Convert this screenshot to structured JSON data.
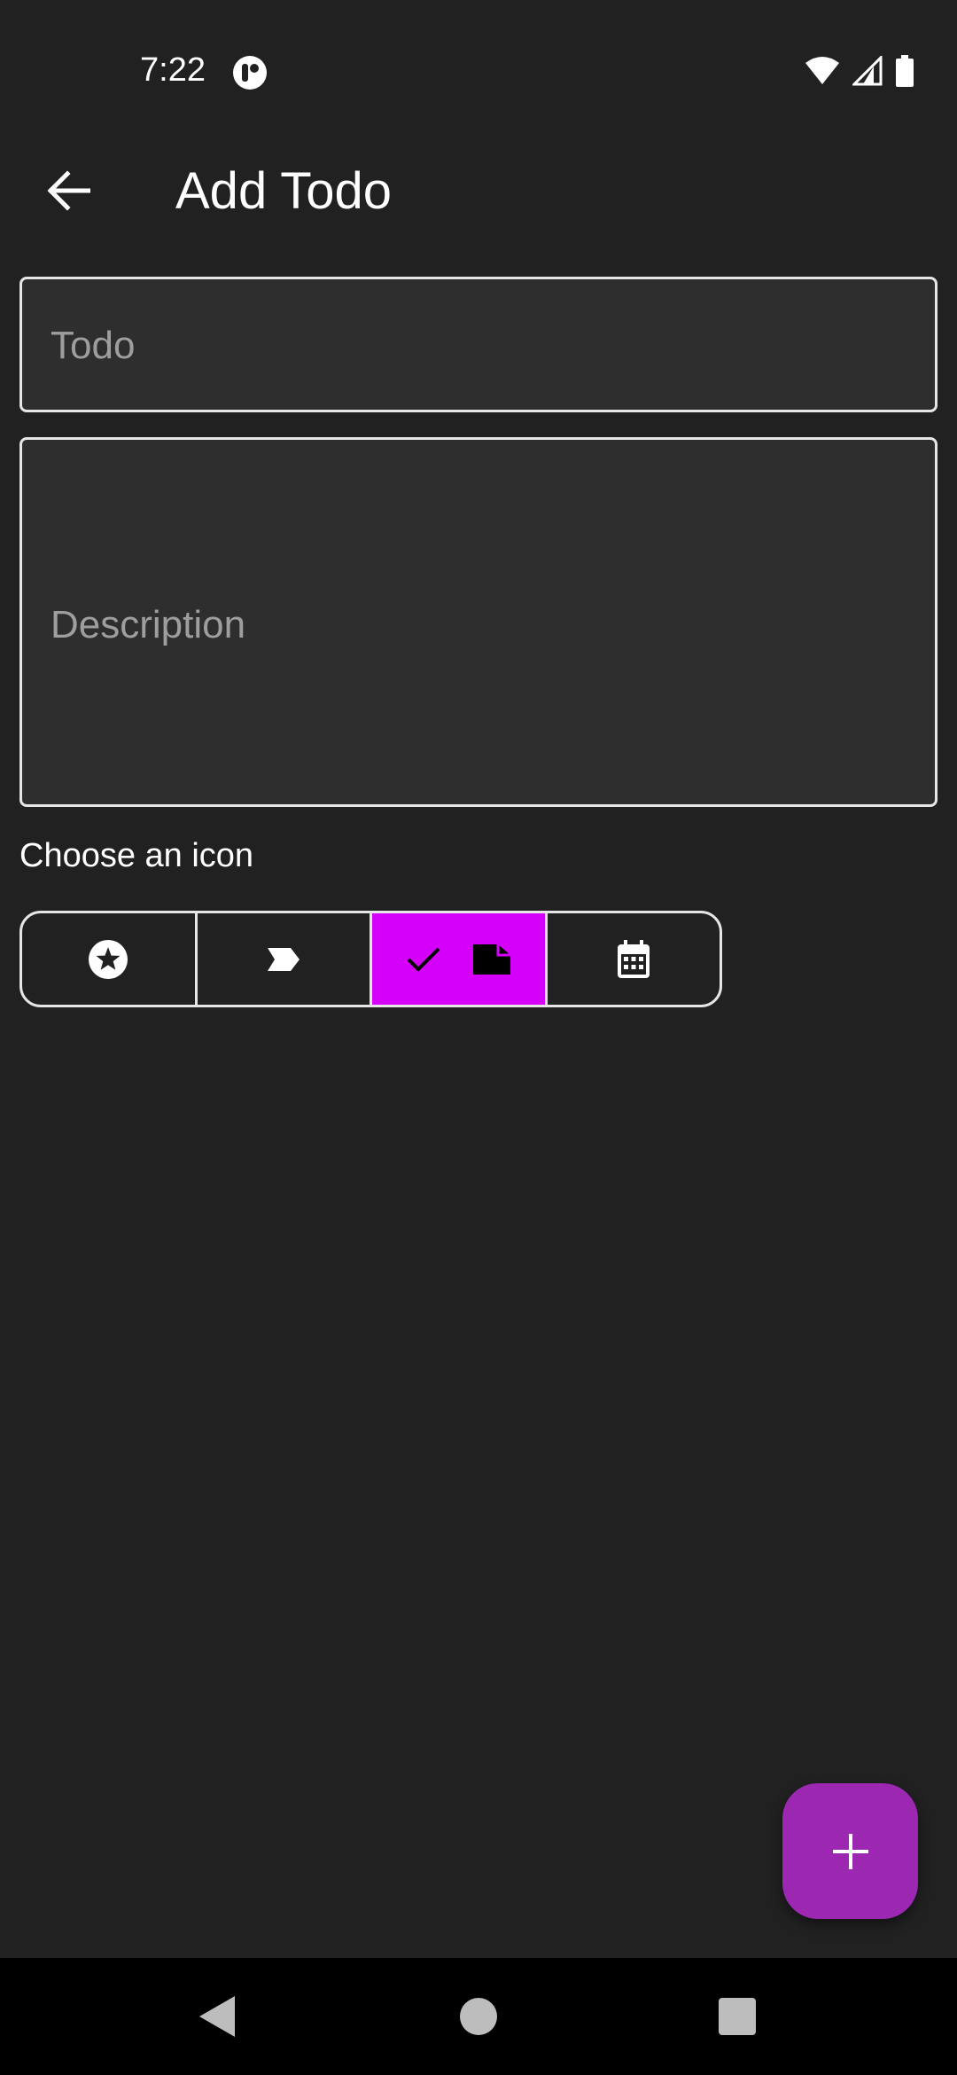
{
  "status_bar": {
    "time": "7:22",
    "icons": [
      "app-notification-icon",
      "wifi-icon",
      "cellular-signal-icon",
      "battery-icon"
    ]
  },
  "app_bar": {
    "back_icon": "arrow-back-icon",
    "title": "Add Todo"
  },
  "form": {
    "todo_placeholder": "Todo",
    "todo_value": "",
    "description_placeholder": "Description",
    "description_value": ""
  },
  "icon_chooser": {
    "label": "Choose an icon",
    "options": [
      {
        "icon": "star-circle-icon",
        "selected": false
      },
      {
        "icon": "label-tag-icon",
        "selected": false
      },
      {
        "icon": "note-icon",
        "selected": true
      },
      {
        "icon": "calendar-icon",
        "selected": false
      }
    ],
    "selected_color": "#d500f9"
  },
  "fab": {
    "icon": "plus-icon",
    "color": "#9c27b0"
  },
  "nav_bar": {
    "buttons": [
      "nav-back-icon",
      "nav-home-icon",
      "nav-recents-icon"
    ]
  },
  "colors": {
    "background": "#212121",
    "field_background": "#2e2e2e",
    "accent": "#d500f9"
  }
}
